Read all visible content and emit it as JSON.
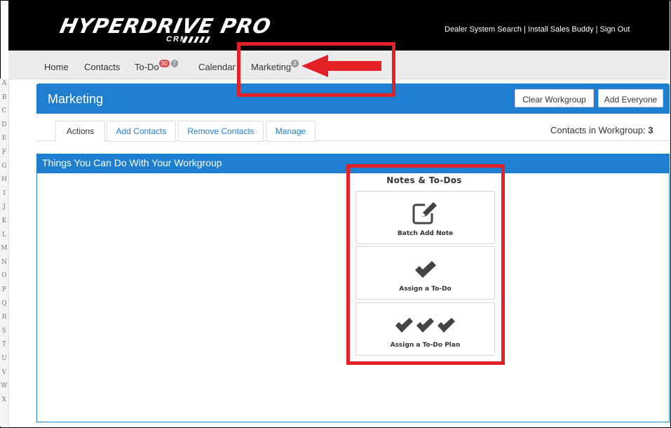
{
  "header": {
    "logo_text": "HYPERDRIVE PRO",
    "logo_sub": "CRM",
    "links": "Dealer System Search | Install Sales Buddy | Sign Out"
  },
  "nav": {
    "home": "Home",
    "contacts": "Contacts",
    "todo": "To-Do",
    "todo_badge_red": "30",
    "todo_badge_gray": "7",
    "calendar": "Calendar",
    "marketing": "Marketing",
    "marketing_badge": "3"
  },
  "alphabet": [
    "A",
    "B",
    "C",
    "D",
    "E",
    "F",
    "G",
    "H",
    "I",
    "J",
    "K",
    "L",
    "M",
    "N",
    "O",
    "P",
    "Q",
    "R",
    "S",
    "T",
    "U",
    "V",
    "W",
    "X"
  ],
  "page": {
    "title": "Marketing",
    "clear_workgroup": "Clear Workgroup",
    "add_everyone": "Add Everyone"
  },
  "tabs": [
    "Actions",
    "Add Contacts",
    "Remove Contacts",
    "Manage"
  ],
  "workgroup": {
    "label": "Contacts in Workgroup: ",
    "count": "3"
  },
  "panel": {
    "title": "Things You Can Do With Your Workgroup",
    "section_title": "Notes & To-Dos",
    "cards": [
      {
        "label": "Batch Add Note",
        "icon": "edit-note-icon"
      },
      {
        "label": "Assign a To-Do",
        "icon": "checkmark-icon"
      },
      {
        "label": "Assign a To-Do Plan",
        "icon": "triple-checkmark-icon"
      }
    ]
  },
  "colors": {
    "primary": "#1e7fd1",
    "annotation": "#e32127",
    "badge_red": "#d9534f"
  }
}
